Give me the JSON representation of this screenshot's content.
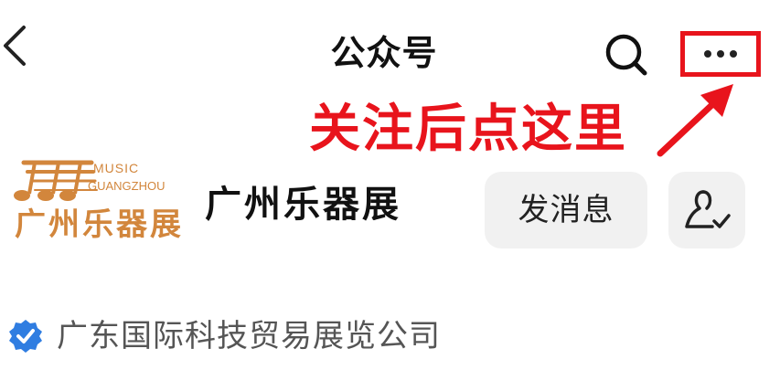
{
  "header": {
    "title": "公众号",
    "back_icon": "chevron-left-icon",
    "search_icon": "search-icon",
    "more_icon": "more-horizontal-icon"
  },
  "annotation": {
    "text": "关注后点这里",
    "color": "#e8141c"
  },
  "account": {
    "logo": {
      "music_text": "MUSIC",
      "city_text": "GUANGZHOU",
      "cn_text": "广州乐器展",
      "color": "#d2863c"
    },
    "name": "广州乐器展",
    "message_button_label": "发消息",
    "follow_icon": "user-followed-icon"
  },
  "verification": {
    "icon": "verified-badge-icon",
    "company": "广东国际科技贸易展览公司",
    "badge_color": "#2f7de1"
  }
}
